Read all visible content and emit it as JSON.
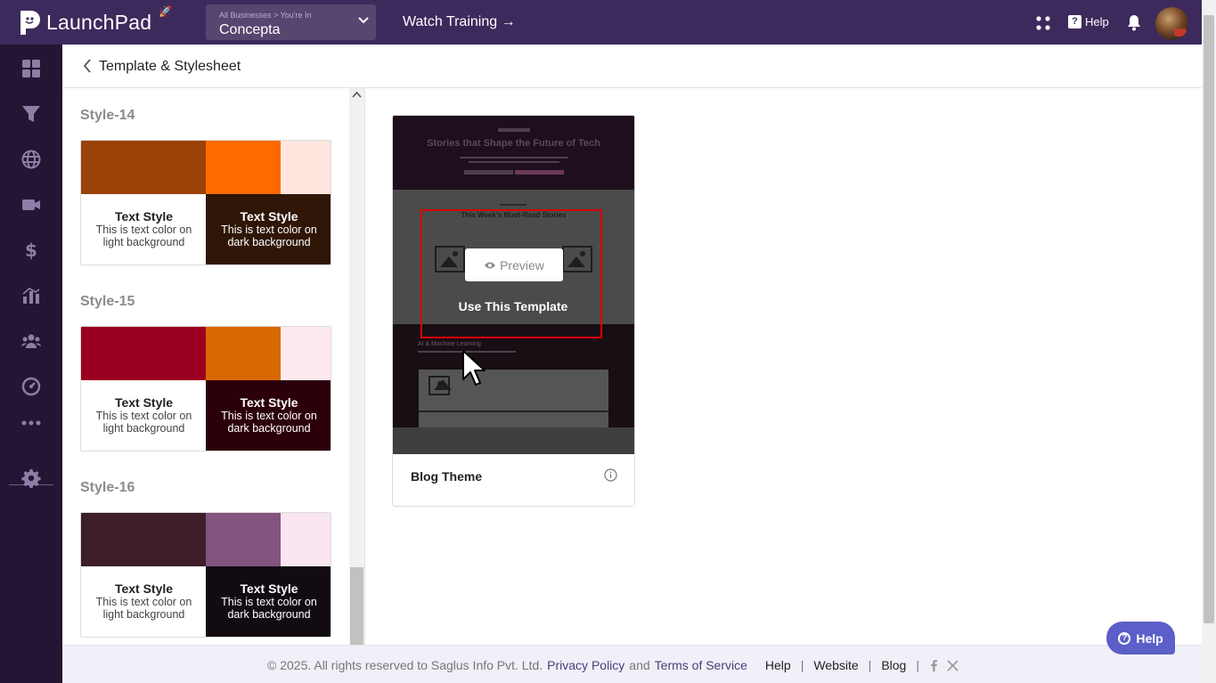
{
  "header": {
    "brand": "LaunchPad",
    "business_sub": "All Businesses > You're In",
    "business_name": "Concepta",
    "watch_training": "Watch Training →",
    "help_label": "Help"
  },
  "sidebar": {
    "items": [
      "dashboard-icon",
      "funnel-icon",
      "globe-icon",
      "video-icon",
      "dollar-icon",
      "chart-icon",
      "users-icon",
      "analytics-icon",
      "more-icon",
      "settings-icon"
    ]
  },
  "page": {
    "title": "Template & Stylesheet"
  },
  "styles": [
    {
      "label": "Style-14",
      "colors": [
        "#9a4207",
        "#ff6a00",
        "#ffe6de"
      ],
      "dark_bg": "#2f1606",
      "light": {
        "title": "Text Style",
        "body": "This is text color on light background"
      },
      "dark": {
        "title": "Text Style",
        "body": "This is text color on dark background"
      }
    },
    {
      "label": "Style-15",
      "colors": [
        "#9b0020",
        "#d96804",
        "#fbe9ee"
      ],
      "dark_bg": "#2c000a",
      "light": {
        "title": "Text Style",
        "body": "This is text color on light background"
      },
      "dark": {
        "title": "Text Style",
        "body": "This is text color on dark background"
      }
    },
    {
      "label": "Style-16",
      "colors": [
        "#3d1e2a",
        "#83547e",
        "#f9e6f1"
      ],
      "dark_bg": "#120c12",
      "light": {
        "title": "Text Style",
        "body": "This is text color on light background"
      },
      "dark": {
        "title": "Text Style",
        "body": "This is text color on dark background"
      }
    }
  ],
  "template": {
    "name": "Blog Theme",
    "preview_label": "Preview",
    "use_label": "Use This Template",
    "thumb_heading": "Stories that Shape the Future of Tech",
    "thumb_subheading": "This Week's Must-Read Stories",
    "thumb_section": "AI & Machine Learning"
  },
  "footer": {
    "copyright": "©  2025. All rights reserved to Saglus Info Pvt. Ltd.",
    "privacy": "Privacy Policy",
    "and": "and",
    "terms": "Terms of Service",
    "help": "Help",
    "website": "Website",
    "blog": "Blog",
    "sep": "|"
  },
  "help_fab": "Help",
  "colors": {
    "topbar": "#3d2a5c",
    "sidebar": "#221634",
    "highlight": "#d80000",
    "help_fab": "#5b5fc7"
  }
}
